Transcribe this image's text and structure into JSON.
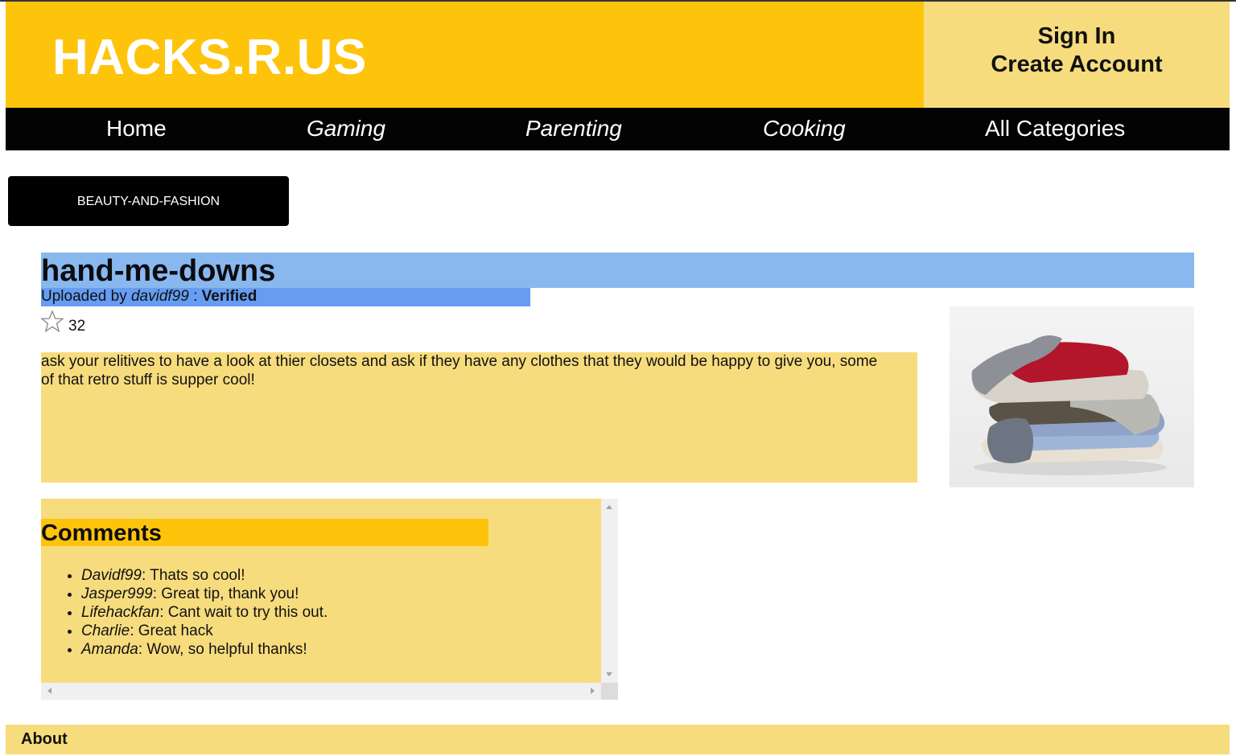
{
  "header": {
    "brand": "HACKS.R.US",
    "sign_in": "Sign In",
    "create_account": "Create Account"
  },
  "nav": {
    "items": [
      {
        "label": "Home"
      },
      {
        "label": "Gaming"
      },
      {
        "label": "Parenting"
      },
      {
        "label": "Cooking"
      },
      {
        "label": "All Categories"
      }
    ]
  },
  "category": "BEAUTY-AND-FASHION",
  "post": {
    "title": "hand-me-downs",
    "uploaded_by_prefix": "Uploaded by",
    "author": "davidf99",
    "separator": " : ",
    "status": "Verified",
    "rating_count": "32",
    "description": "ask your relitives to have a look at thier closets and ask if they have any clothes that they would be happy to give you, some of that retro stuff is supper cool!",
    "image_icon": "clothes-pile-photo"
  },
  "comments": {
    "heading": "Comments",
    "items": [
      {
        "user": "Davidf99",
        "text": ": Thats so cool!"
      },
      {
        "user": "Jasper999",
        "text": ": Great tip, thank you!"
      },
      {
        "user": "Lifehackfan",
        "text": ": Cant wait to try this out."
      },
      {
        "user": "Charlie",
        "text": ": Great hack"
      },
      {
        "user": "Amanda",
        "text": ": Wow, so helpful thanks!"
      }
    ]
  },
  "footer": {
    "about": "About"
  },
  "colors": {
    "brand_yellow": "#fec40c",
    "pale_yellow": "#f7dc7e",
    "title_blue": "#89b8ef",
    "uploader_blue": "#669df0",
    "nav_black": "#030303"
  }
}
